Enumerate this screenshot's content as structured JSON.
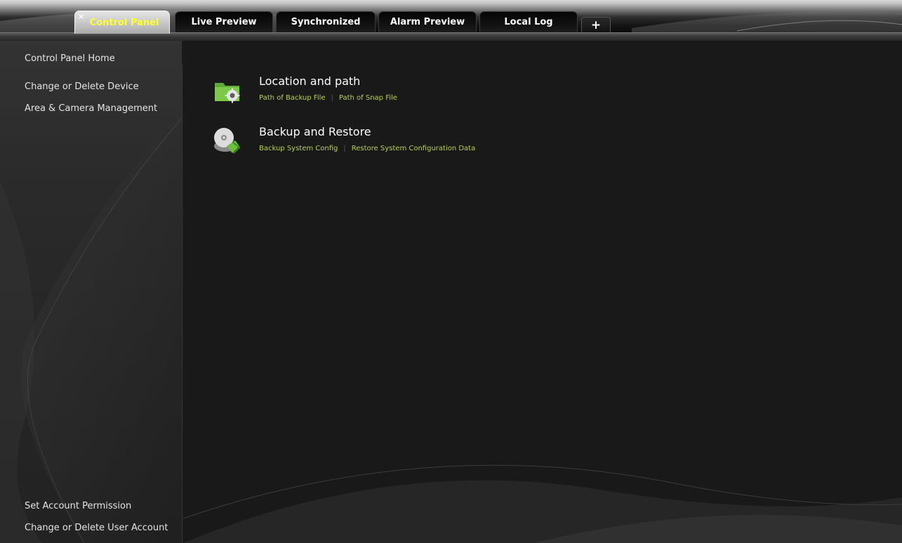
{
  "tabs": {
    "close_glyph": "×",
    "add_glyph": "+",
    "items": [
      {
        "label": "Control Panel",
        "active": true
      },
      {
        "label": "Live Preview",
        "active": false
      },
      {
        "label": "Synchronized",
        "active": false
      },
      {
        "label": "Alarm Preview",
        "active": false
      },
      {
        "label": "Local Log",
        "active": false
      }
    ]
  },
  "sidebar": {
    "top_items": [
      {
        "label": "Control Panel Home"
      },
      {
        "label": "Change or Delete Device"
      },
      {
        "label": "Area & Camera Management"
      }
    ],
    "bottom_items": [
      {
        "label": "Set Account Permission"
      },
      {
        "label": "Change or Delete User Account"
      }
    ]
  },
  "main": {
    "sections": [
      {
        "title": "Location and path",
        "icon": "folder-gear-icon",
        "links": [
          {
            "label": "Path of Backup File"
          },
          {
            "label": "Path of Snap File"
          }
        ]
      },
      {
        "title": "Backup and Restore",
        "icon": "disc-backup-icon",
        "links": [
          {
            "label": "Backup System Config"
          },
          {
            "label": "Restore System Configuration Data"
          }
        ]
      }
    ]
  },
  "colors": {
    "active_tab_text": "#ffff2a",
    "link_text": "#b8cf5a",
    "background": "#191919"
  }
}
